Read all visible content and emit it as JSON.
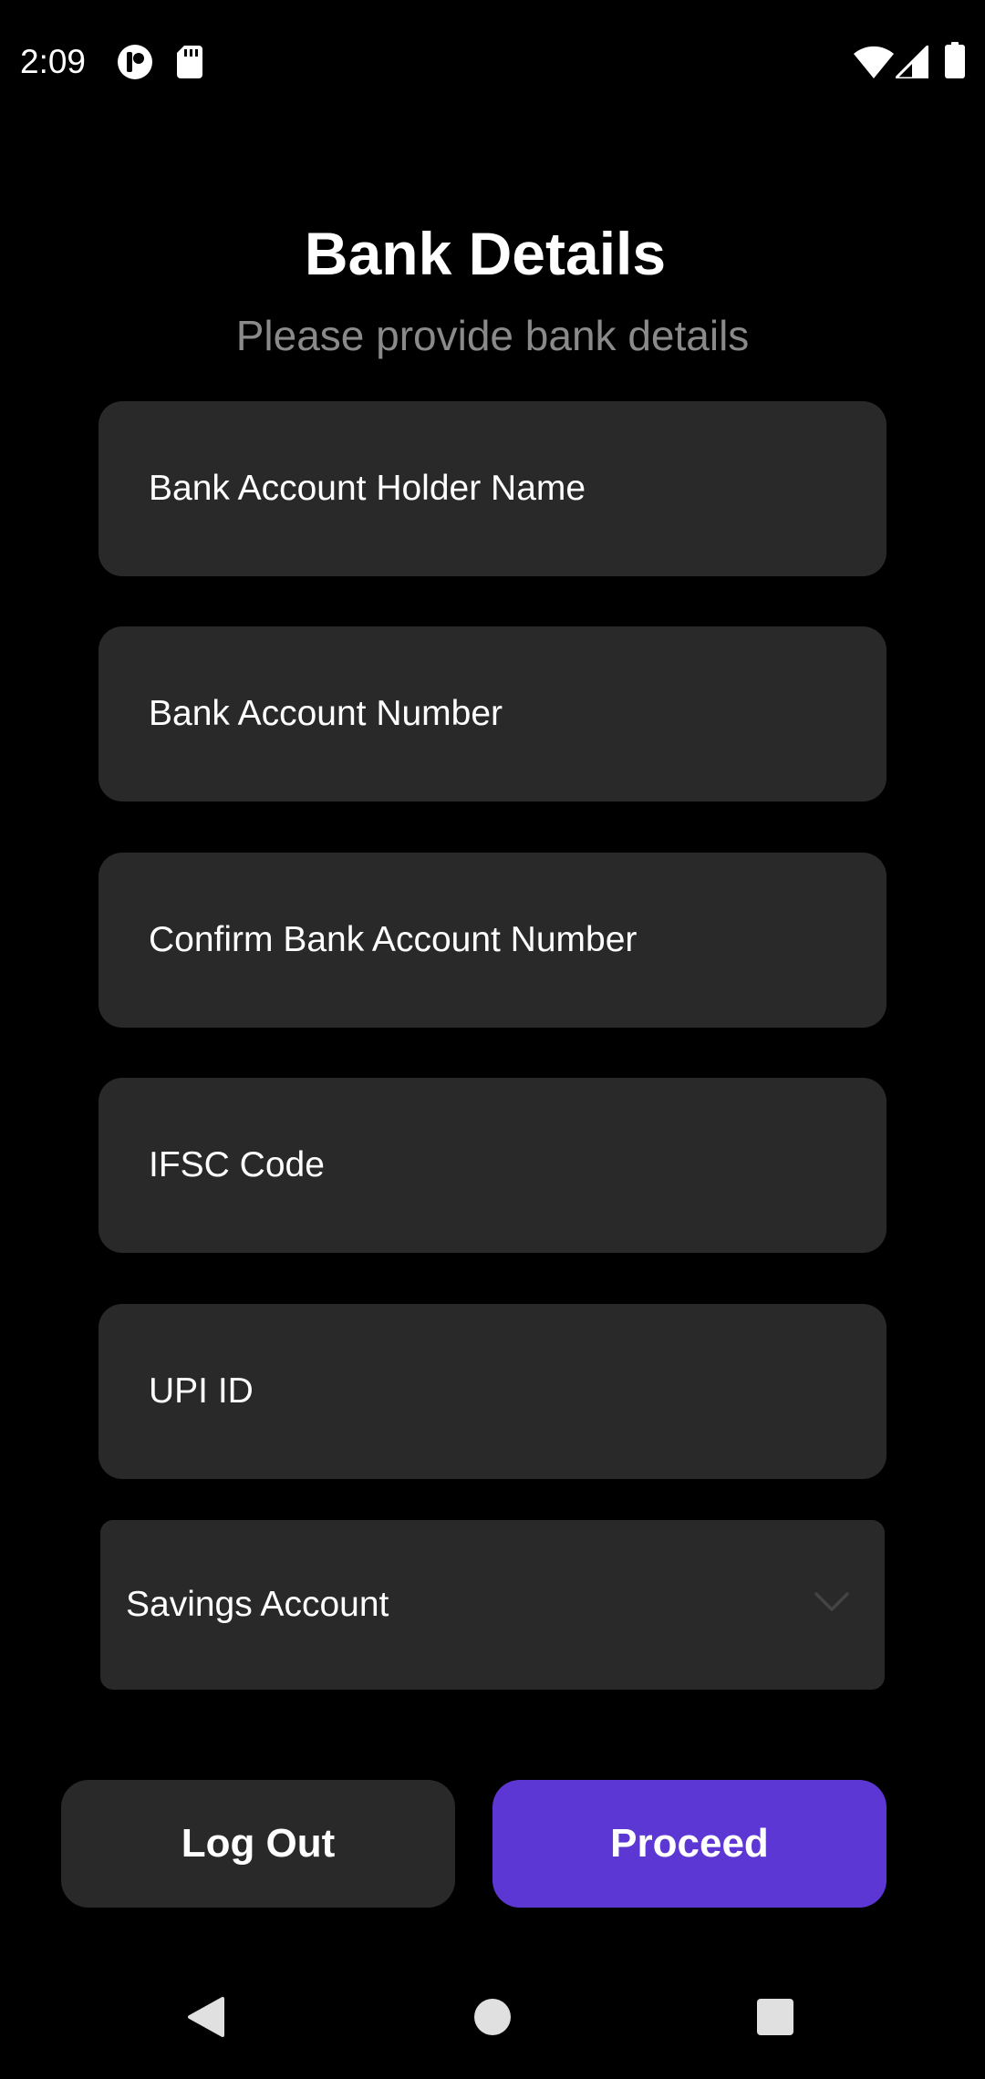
{
  "status_bar": {
    "time": "2:09",
    "icons": [
      "notification-app-icon",
      "sd-card-icon",
      "wifi-icon",
      "cellular-signal-icon",
      "battery-icon"
    ]
  },
  "header": {
    "title": "Bank Details",
    "subtitle": "Please provide bank details"
  },
  "form": {
    "fields": [
      {
        "placeholder": "Bank Account Holder Name",
        "value": ""
      },
      {
        "placeholder": "Bank Account Number",
        "value": ""
      },
      {
        "placeholder": "Confirm Bank Account Number",
        "value": ""
      },
      {
        "placeholder": "IFSC Code",
        "value": ""
      },
      {
        "placeholder": "UPI ID",
        "value": ""
      }
    ],
    "account_type": {
      "selected": "Savings Account",
      "icon": "chevron-down-icon"
    }
  },
  "actions": {
    "logout_label": "Log Out",
    "proceed_label": "Proceed"
  },
  "nav_bar": {
    "icons": [
      "back-icon",
      "home-icon",
      "recents-icon"
    ]
  },
  "colors": {
    "background": "#000000",
    "field_background": "#292929",
    "subtitle_text": "#8a8a8a",
    "accent": "#5d37d4",
    "chevron": "#444444",
    "nav_icon": "#e0e0e0"
  }
}
